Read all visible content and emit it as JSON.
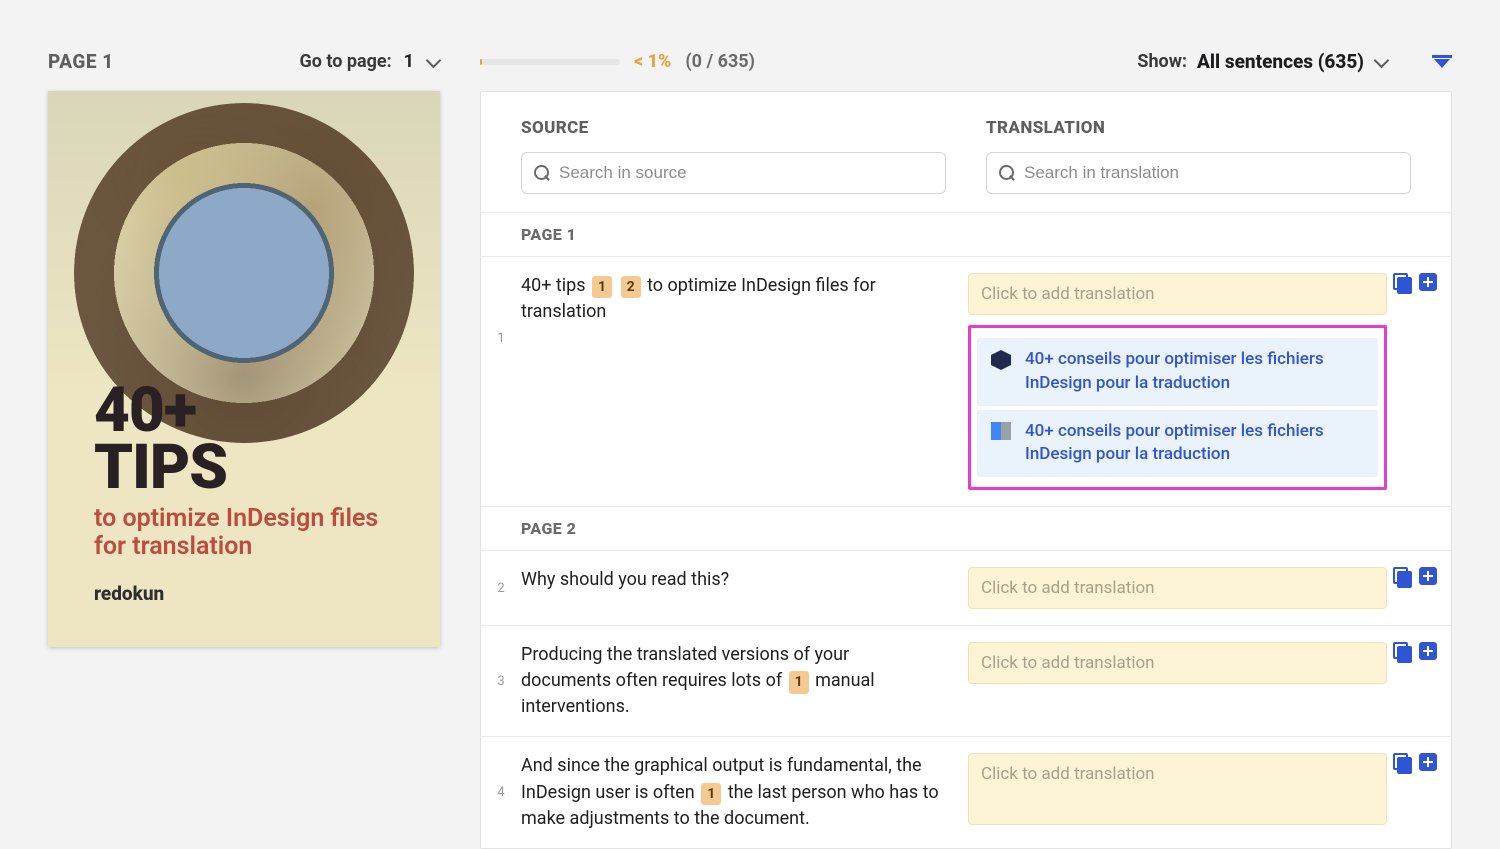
{
  "left": {
    "page_label": "PAGE 1",
    "goto_label": "Go to page:",
    "goto_value": "1",
    "preview": {
      "big_line1": "40+",
      "big_line2": "TIPS",
      "sub": "to optimize InDesign files for translation",
      "brand": "redokun"
    }
  },
  "topbar": {
    "percent": "< 1%",
    "counts": "(0 / 635)",
    "show_label": "Show:",
    "show_value": "All sentences (635)"
  },
  "columns": {
    "source_title": "SOURCE",
    "translation_title": "TRANSLATION",
    "source_placeholder": "Search in source",
    "translation_placeholder": "Search in translation"
  },
  "translation_placeholder_text": "Click to add translation",
  "page_headers": {
    "p1": "PAGE 1",
    "p2": "PAGE 2"
  },
  "segments": {
    "s1": {
      "num": "1",
      "source_before": "40+ tips ",
      "tag1": "1",
      "tag2": "2",
      "source_after": " to optimize InDesign files for translation",
      "suggestion1": "40+ conseils pour optimiser les fichiers InDesign pour la traduction",
      "suggestion2": "40+ conseils pour optimiser les fichiers InDesign pour la traduction"
    },
    "s2": {
      "num": "2",
      "source": "Why should you read this?"
    },
    "s3": {
      "num": "3",
      "source_before": "Producing the translated versions of your documents often requires lots of ",
      "tag1": "1",
      "source_after": " manual interventions."
    },
    "s4": {
      "num": "4",
      "source_before": "And since the graphical output is fundamental, the InDesign user is often ",
      "tag1": "1",
      "source_after": " the last person who has to make adjustments to the document."
    }
  }
}
